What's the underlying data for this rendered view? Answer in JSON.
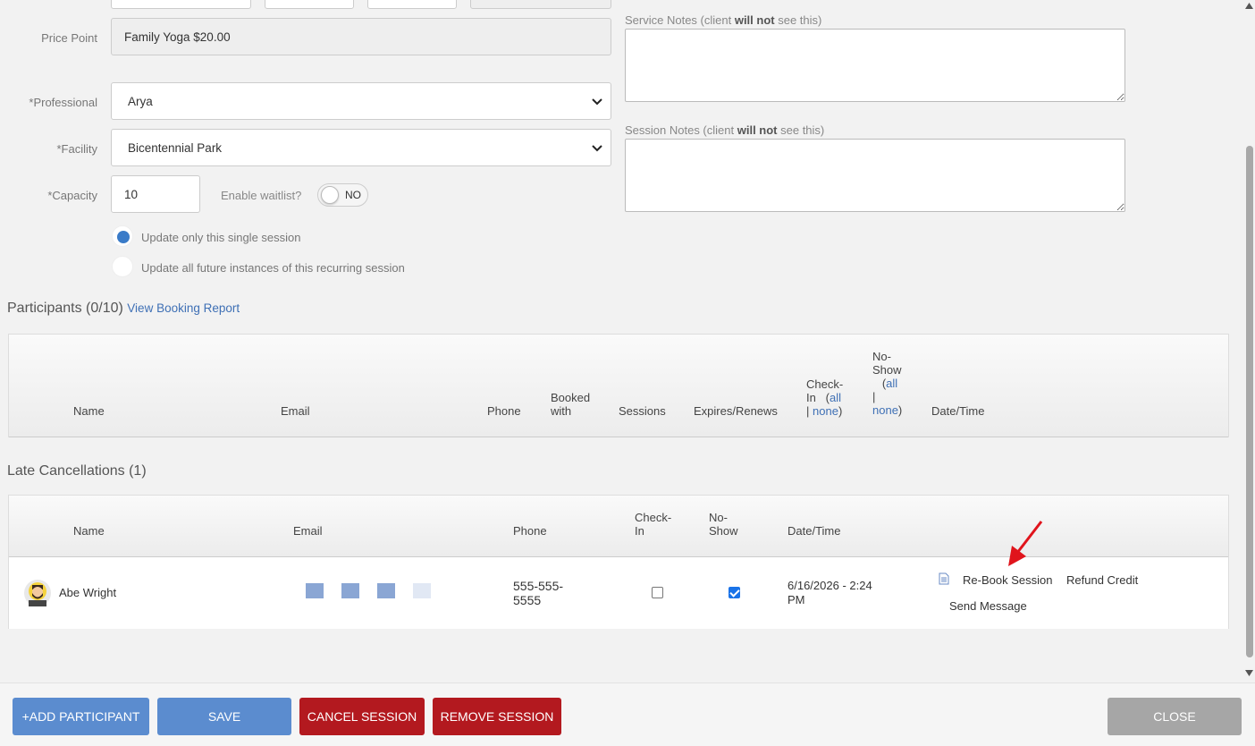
{
  "form": {
    "price_point_label": "Price Point",
    "price_point_value": "Family Yoga $20.00",
    "professional_label": "*Professional",
    "professional_value": "Arya",
    "facility_label": "*Facility",
    "facility_value": "Bicentennial Park",
    "capacity_label": "*Capacity",
    "capacity_value": "10",
    "waitlist_label": "Enable waitlist?",
    "waitlist_toggle": "NO",
    "radio_single": "Update only this single session",
    "radio_all": "Update all future instances of this recurring session"
  },
  "notes": {
    "service_prefix": "Service Notes (client ",
    "service_bold": "will not",
    "service_suffix": " see this)",
    "session_prefix": "Session Notes (client ",
    "session_bold": "will not",
    "session_suffix": " see this)"
  },
  "participants": {
    "title": "Participants (0/10)",
    "report_link": "View Booking Report",
    "headers": {
      "name": "Name",
      "email": "Email",
      "phone": "Phone",
      "booked_with_1": "Booked",
      "booked_with_2": "with",
      "sessions": "Sessions",
      "expires": "Expires/Renews",
      "checkin_1": "Check-",
      "checkin_2": "In",
      "all": "all",
      "pipe": "|",
      "none": "none",
      "noshow_1": "No-",
      "noshow_2": "Show",
      "datetime": "Date/Time"
    }
  },
  "late": {
    "title": "Late Cancellations (1)",
    "headers": {
      "name": "Name",
      "email": "Email",
      "phone": "Phone",
      "checkin_1": "Check-",
      "checkin_2": "In",
      "noshow_1": "No-",
      "noshow_2": "Show",
      "datetime": "Date/Time"
    },
    "row": {
      "name": "Abe Wright",
      "phone_1": "555-555-",
      "phone_2": "5555",
      "checkin": false,
      "noshow": true,
      "date_1": "6/16/2026 - 2:24",
      "date_2": "PM",
      "rebook": "Re-Book Session",
      "refund": "Refund Credit",
      "message": "Send Message"
    }
  },
  "footer": {
    "add": "+ADD PARTICIPANT",
    "save": "SAVE",
    "cancel": "CANCEL SESSION",
    "remove": "REMOVE SESSION",
    "close": "CLOSE"
  },
  "colors": {
    "link": "#3f70b5",
    "primary_button": "#5b8ccf",
    "danger_button": "#b3191f",
    "close_button": "#a6a6a6",
    "annotation_arrow": "#e0141c"
  }
}
